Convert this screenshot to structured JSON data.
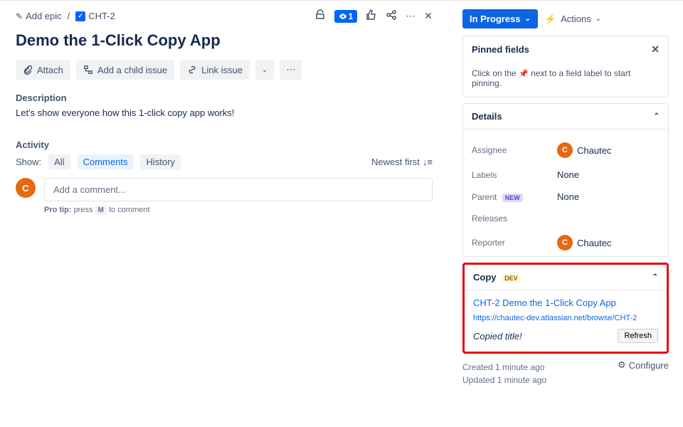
{
  "breadcrumb": {
    "add_epic": "Add epic",
    "issue_key": "CHT-2"
  },
  "top_actions": {
    "watchers": "1"
  },
  "title": "Demo the 1-Click Copy App",
  "toolbar": {
    "attach": "Attach",
    "add_child": "Add a child issue",
    "link": "Link issue"
  },
  "description": {
    "label": "Description",
    "text": "Let's show everyone how this 1-click copy app works!"
  },
  "activity": {
    "label": "Activity",
    "show": "Show:",
    "all": "All",
    "comments": "Comments",
    "history": "History",
    "sort": "Newest first",
    "avatar_initial": "C",
    "comment_placeholder": "Add a comment...",
    "protip_pre": "Pro tip:",
    "protip_mid": "press",
    "protip_key": "M",
    "protip_post": "to comment"
  },
  "status": {
    "label": "In Progress",
    "actions": "Actions"
  },
  "pinned": {
    "header": "Pinned fields",
    "hint_pre": "Click on the",
    "hint_post": "next to a field label to start pinning."
  },
  "details": {
    "header": "Details",
    "assignee": {
      "label": "Assignee",
      "initial": "C",
      "name": "Chautec"
    },
    "labels": {
      "label": "Labels",
      "value": "None"
    },
    "parent": {
      "label": "Parent",
      "badge": "NEW",
      "value": "None"
    },
    "releases": {
      "label": "Releases"
    },
    "reporter": {
      "label": "Reporter",
      "initial": "C",
      "name": "Chautec"
    }
  },
  "copy": {
    "header": "Copy",
    "badge": "DEV",
    "title_link": "CHT-2 Demo the 1-Click Copy App",
    "url": "https://chautec-dev.atlassian.net/browse/CHT-2",
    "copied": "Copied title!",
    "refresh": "Refresh"
  },
  "meta": {
    "created": "Created 1 minute ago",
    "updated": "Updated 1 minute ago",
    "configure": "Configure"
  }
}
